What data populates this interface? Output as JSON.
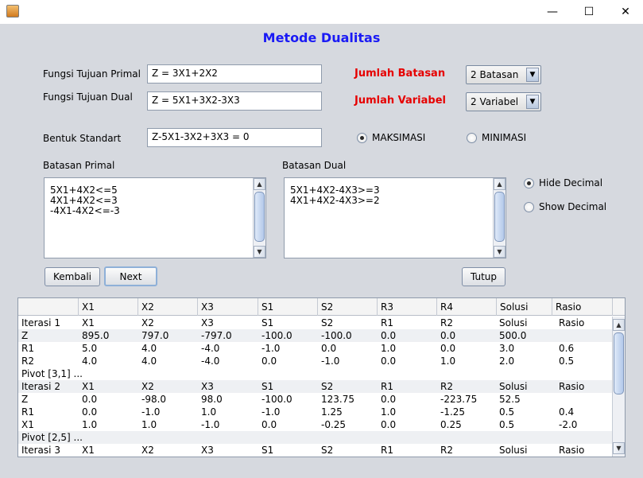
{
  "window": {
    "minimize": "—",
    "maximize": "☐",
    "close": "✕"
  },
  "heading": "Metode Dualitas",
  "form": {
    "primal_label": "Fungsi Tujuan Primal",
    "primal_value": "Z = 3X1+2X2",
    "dual_label": "Fungsi Tujuan Dual",
    "dual_value": "Z = 5X1+3X2-3X3",
    "standard_label": "Bentuk Standart",
    "standard_value": "Z-5X1-3X2+3X3 = 0",
    "jumlah_batasan_label": "Jumlah Batasan",
    "jumlah_batasan_value": "2 Batasan",
    "jumlah_variabel_label": "Jumlah Variabel",
    "jumlah_variabel_value": "2 Variabel",
    "maksimasi_label": "MAKSIMASI",
    "minimasi_label": "MINIMASI",
    "selected_optimization": "MAKSIMASI"
  },
  "batasan_primal": {
    "label": "Batasan Primal",
    "lines": [
      "5X1+4X2<=5",
      "4X1+4X2<=3",
      "-4X1-4X2<=-3"
    ]
  },
  "batasan_dual": {
    "label": "Batasan Dual",
    "lines": [
      "5X1+4X2-4X3>=3",
      "4X1+4X2-4X3>=2"
    ]
  },
  "decimal": {
    "hide_label": "Hide Decimal",
    "show_label": "Show Decimal",
    "selected": "Hide Decimal"
  },
  "buttons": {
    "kembali": "Kembali",
    "next": "Next",
    "tutup": "Tutup"
  },
  "table": {
    "headers": [
      "",
      "X1",
      "X2",
      "X3",
      "S1",
      "S2",
      "R3",
      "R4",
      "Solusi",
      "Rasio"
    ],
    "rows": [
      [
        "Iterasi 1",
        "X1",
        "X2",
        "X3",
        "S1",
        "S2",
        "R1",
        "R2",
        "Solusi",
        "Rasio"
      ],
      [
        "Z",
        "895.0",
        "797.0",
        "-797.0",
        "-100.0",
        "-100.0",
        "0.0",
        "0.0",
        "500.0",
        ""
      ],
      [
        "R1",
        "5.0",
        "4.0",
        "-4.0",
        "-1.0",
        "0.0",
        "1.0",
        "0.0",
        "3.0",
        "0.6"
      ],
      [
        "R2",
        "4.0",
        "4.0",
        "-4.0",
        "0.0",
        "-1.0",
        "0.0",
        "1.0",
        "2.0",
        "0.5"
      ],
      [
        "Pivot [3,1] ...",
        "",
        "",
        "",
        "",
        "",
        "",
        "",
        "",
        ""
      ],
      [
        "Iterasi 2",
        "X1",
        "X2",
        "X3",
        "S1",
        "S2",
        "R1",
        "R2",
        "Solusi",
        "Rasio"
      ],
      [
        "Z",
        "0.0",
        "-98.0",
        "98.0",
        "-100.0",
        "123.75",
        "0.0",
        "-223.75",
        "52.5",
        ""
      ],
      [
        "R1",
        "0.0",
        "-1.0",
        "1.0",
        "-1.0",
        "1.25",
        "1.0",
        "-1.25",
        "0.5",
        "0.4"
      ],
      [
        "X1",
        "1.0",
        "1.0",
        "-1.0",
        "0.0",
        "-0.25",
        "0.0",
        "0.25",
        "0.5",
        "-2.0"
      ],
      [
        "Pivot [2,5] ...",
        "",
        "",
        "",
        "",
        "",
        "",
        "",
        "",
        ""
      ],
      [
        "Iterasi 3",
        "X1",
        "X2",
        "X3",
        "S1",
        "S2",
        "R1",
        "R2",
        "Solusi",
        "Rasio"
      ]
    ],
    "highlighted_rows": [
      1,
      5,
      9
    ]
  }
}
